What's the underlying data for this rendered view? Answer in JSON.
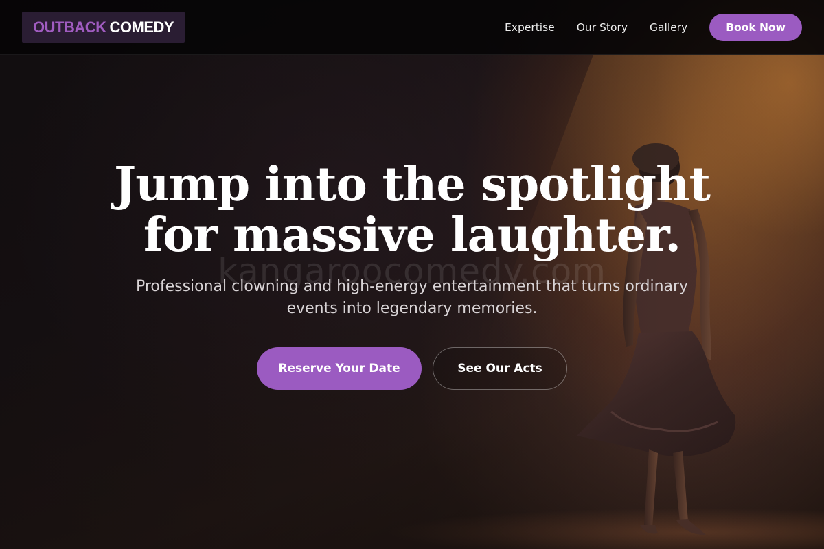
{
  "header": {
    "logo_accent": "OUTBACK",
    "logo_main": "COMEDY",
    "nav": [
      "Expertise",
      "Our Story",
      "Gallery"
    ],
    "cta_label": "Book Now"
  },
  "hero": {
    "title_line1": "Jump into the spotlight",
    "title_line2": "for massive laughter.",
    "subtitle_line1": "Professional clowning and high-energy entertainment that turns ordinary",
    "subtitle_line2": "events into legendary memories.",
    "primary_cta": "Reserve Your Date",
    "secondary_cta": "See Our Acts",
    "watermark": "kangaroocomedy.com"
  },
  "colors": {
    "accent": "#9b5bc1",
    "logo_accent": "#a05cc0",
    "header_bg": "#060506",
    "logo_bg": "#2a1d33"
  }
}
